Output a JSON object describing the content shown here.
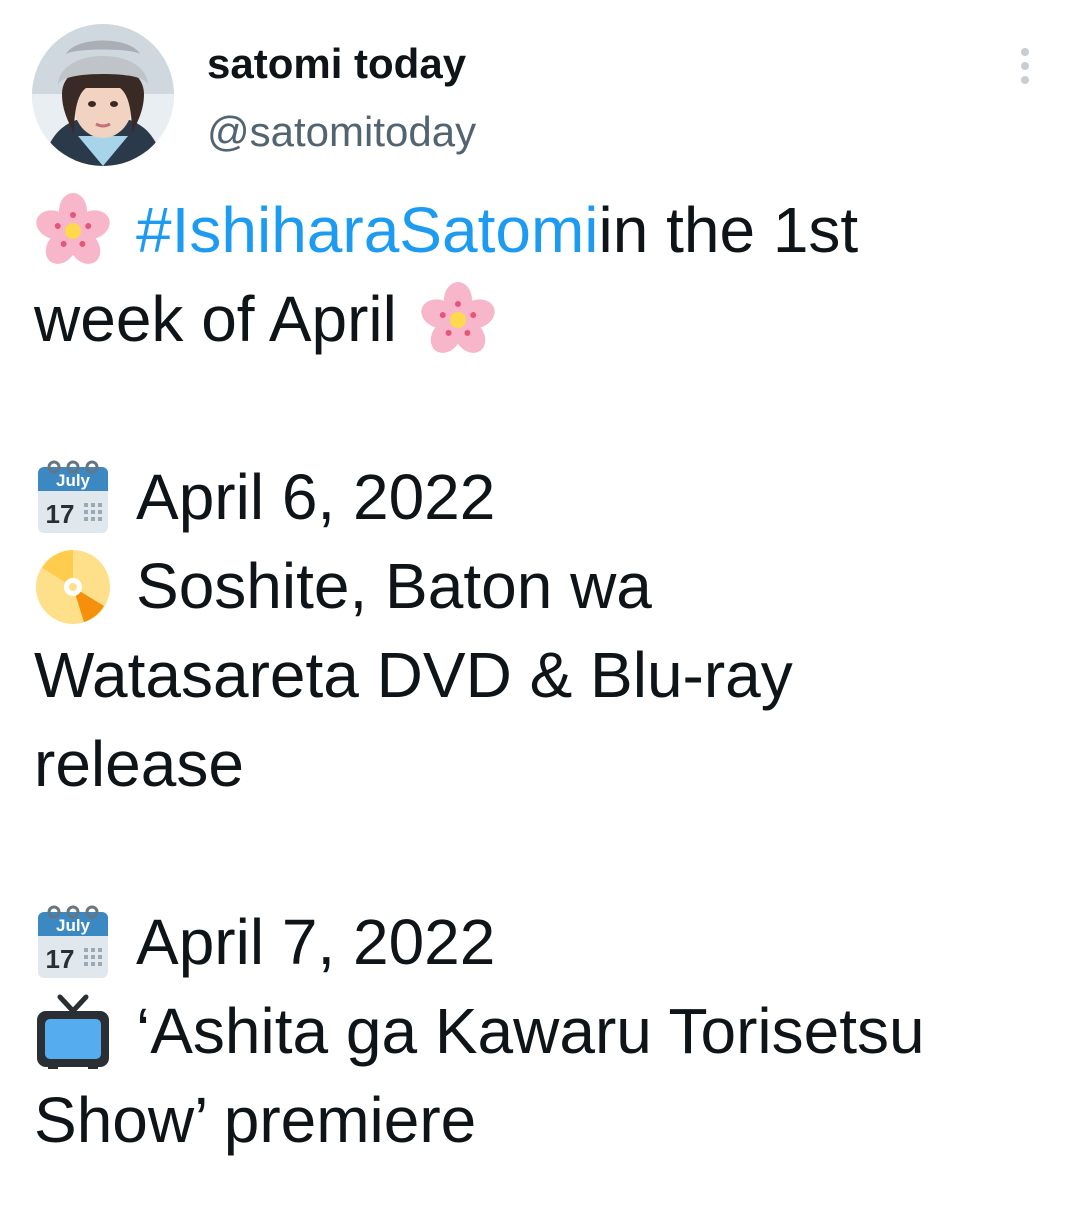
{
  "user": {
    "display_name": "satomi today",
    "handle": "@satomitoday"
  },
  "tweet": {
    "hashtag": "#IshiharaSatomi",
    "line1_rest": " in the 1st",
    "line2": "week of April",
    "date1": "April 6, 2022",
    "item1_line1": "Soshite, Baton wa",
    "item1_line2": "Watasareta DVD & Blu-ray",
    "item1_line3": "release",
    "date2": "April 7, 2022",
    "item2_line1": "‘Ashita ga Kawaru Torisetsu",
    "item2_line2": "Show’ premiere",
    "calendar_month": "July",
    "calendar_day": "17"
  },
  "icons": {
    "flower": "cherry-blossom-icon",
    "calendar": "calendar-icon",
    "disc": "dvd-icon",
    "tv": "television-icon",
    "more": "more-options-icon"
  },
  "colors": {
    "hashtag": "#1d9bf0",
    "text": "#0f1419",
    "secondary": "#536471"
  }
}
